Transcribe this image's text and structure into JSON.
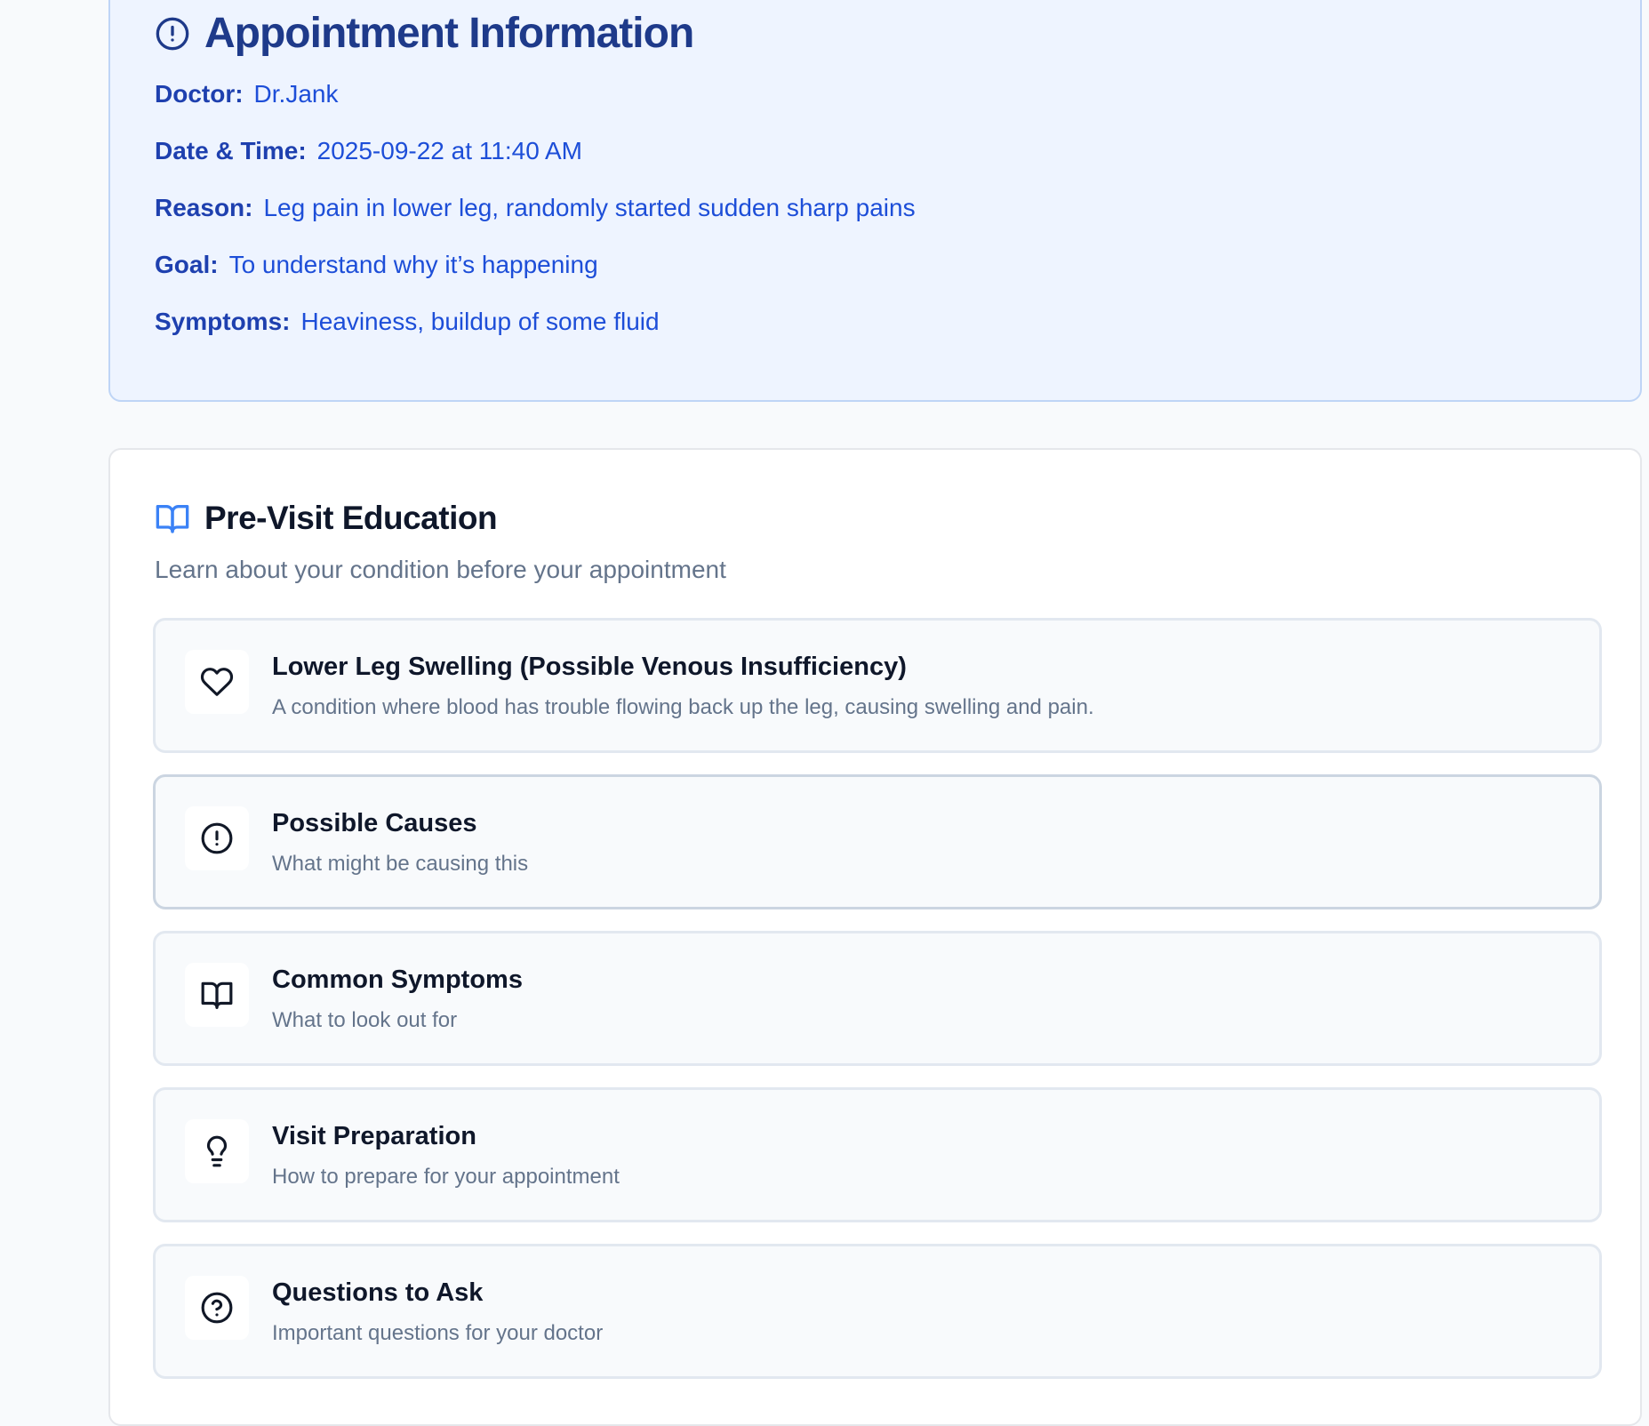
{
  "appointment": {
    "title": "Appointment Information",
    "icon": "alert-circle-icon",
    "fields": [
      {
        "label": "Doctor:",
        "value": "Dr.Jank"
      },
      {
        "label": "Date & Time:",
        "value": "2025-09-22 at 11:40 AM"
      },
      {
        "label": "Reason:",
        "value": "Leg pain in lower leg, randomly started sudden sharp pains"
      },
      {
        "label": "Goal:",
        "value": "To understand why it’s happening"
      },
      {
        "label": "Symptoms:",
        "value": "Heaviness, buildup of some fluid"
      }
    ]
  },
  "education": {
    "title": "Pre-Visit Education",
    "icon": "book-open-icon",
    "subtitle": "Learn about your condition before your appointment",
    "topics": [
      {
        "icon": "heart-icon",
        "title": "Lower Leg Swelling (Possible Venous Insufficiency)",
        "description": "A condition where blood has trouble flowing back up the leg, causing swelling and pain."
      },
      {
        "icon": "alert-circle-icon",
        "title": "Possible Causes",
        "description": "What might be causing this"
      },
      {
        "icon": "book-open-icon",
        "title": "Common Symptoms",
        "description": "What to look out for"
      },
      {
        "icon": "lightbulb-icon",
        "title": "Visit Preparation",
        "description": "How to prepare for your appointment"
      },
      {
        "icon": "help-circle-icon",
        "title": "Questions to Ask",
        "description": "Important questions for your doctor"
      }
    ]
  },
  "colors": {
    "background": "#f8fafc",
    "appointment_card_bg": "#eef4ff",
    "appointment_card_border": "#bfd5f6",
    "accent_dark_blue": "#1e3a8a",
    "accent_blue": "#1d4ed8",
    "education_icon_blue": "#3b82f6",
    "muted_text": "#64748b"
  }
}
